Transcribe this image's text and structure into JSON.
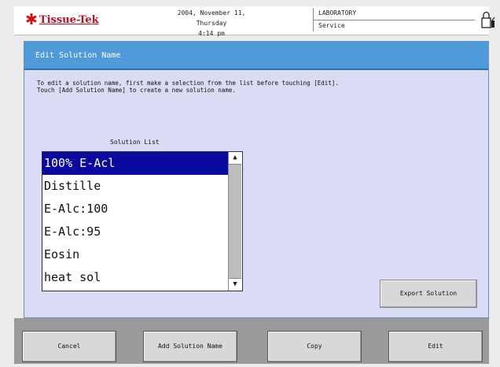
{
  "header": {
    "logo_text": "Tissue-Tek",
    "logo_star": "✱",
    "date_line": "2004, November 11, Thursday",
    "time_line": "4:14 pm",
    "mode_line1": "LABORATORY",
    "mode_line2": "Service"
  },
  "panel": {
    "title": "Edit Solution Name",
    "instructions": "To edit a solution name, first make a selection from the list before touching [Edit].\nTouch [Add Solution Name] to create a new solution name.",
    "list_label": "Solution List",
    "items": [
      "100% E-Acl",
      "Distille",
      "E-Alc:100",
      "E-Alc:95",
      "Eosin",
      "heat sol"
    ],
    "selected_index": 0,
    "export_label": "Export Solution"
  },
  "footer": {
    "cancel_label": "Cancel",
    "add_label": "Add Solution Name",
    "copy_label": "Copy",
    "edit_label": "Edit"
  },
  "icons": {
    "lock": "lock-icon",
    "scroll_up": "scroll-up-arrow-icon",
    "scroll_down": "scroll-down-arrow-icon"
  },
  "colors": {
    "title_bar": "#4f9ad8",
    "panel_bg": "#d9dcf4",
    "selection": "#0a0aa0",
    "logo_red": "#c01020"
  }
}
